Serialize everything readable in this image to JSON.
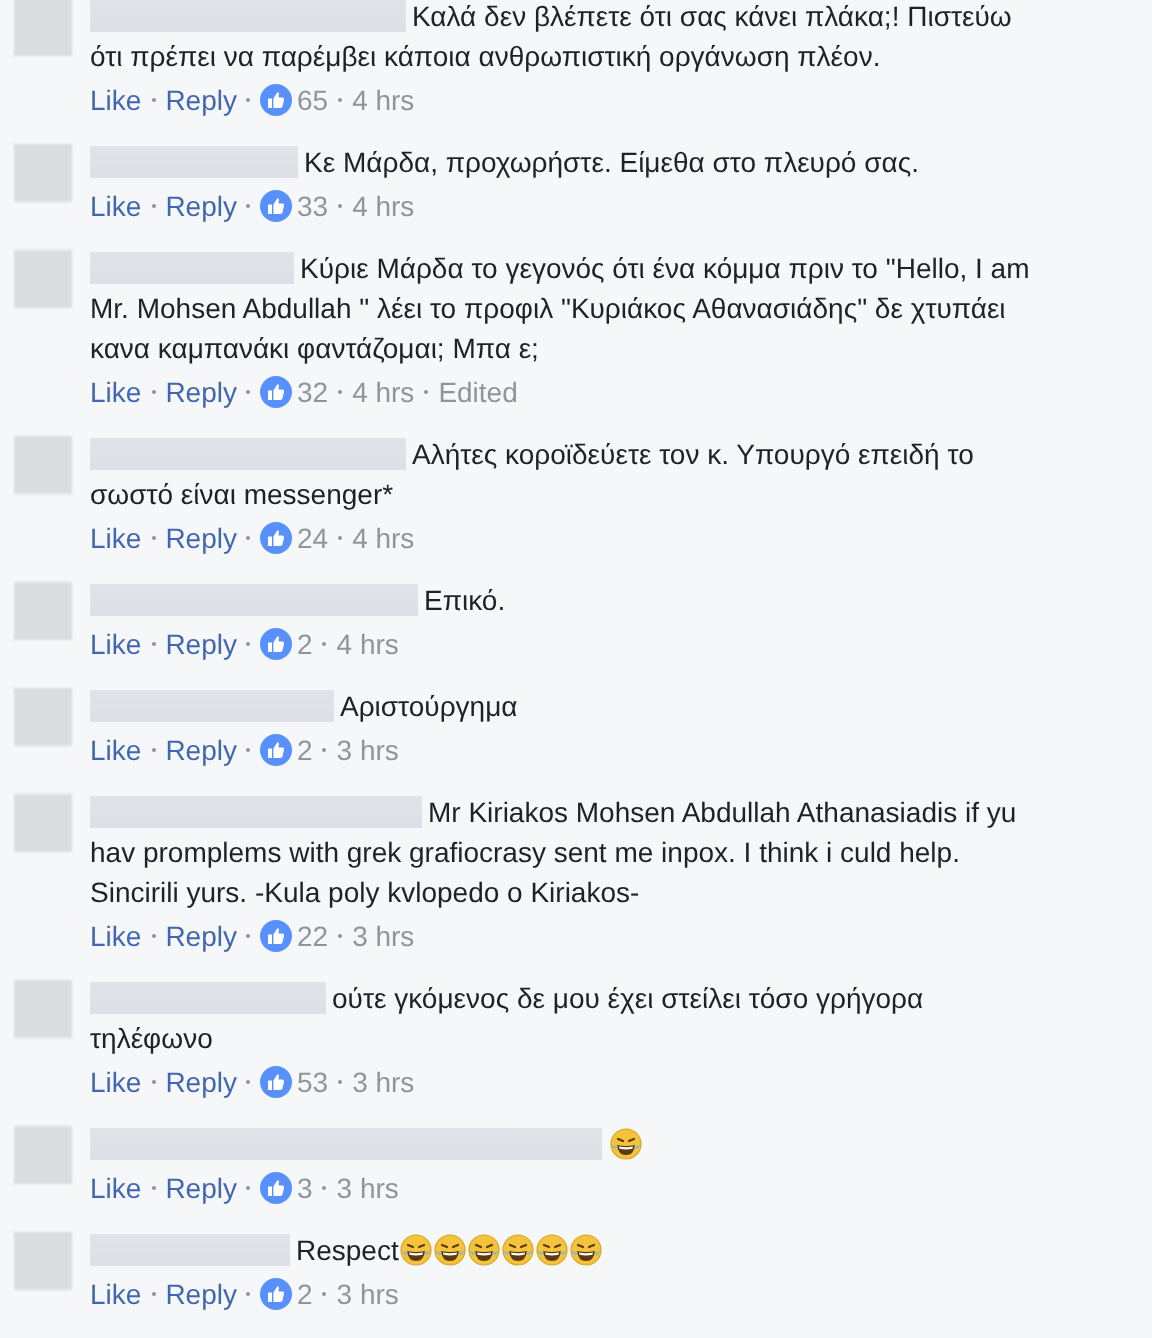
{
  "comments": [
    {
      "text": "Καλά δεν βλέπετε ότι σας κάνει πλάκα;! Πιστεύω ότι πρέπει να παρέμβει κάποια ανθρωπιστική οργάνωση πλέον.",
      "like_label": "Like",
      "reply_label": "Reply",
      "likes": "65",
      "time": "4 hrs"
    },
    {
      "text": "Κε Μάρδα, προχωρήστε. Είμεθα στο πλευρό σας.",
      "like_label": "Like",
      "reply_label": "Reply",
      "likes": "33",
      "time": "4 hrs"
    },
    {
      "text": "Κύριε Μάρδα το γεγονός ότι ένα κόμμα πριν το \"Hello, I am Mr. Mohsen Abdullah \" λέει το προφιλ \"Κυριάκος Αθανασιάδης\" δε χτυπάει κανα καμπανάκι φαντάζομαι; Μπα ε;",
      "like_label": "Like",
      "reply_label": "Reply",
      "likes": "32",
      "time": "4 hrs",
      "edited": "Edited"
    },
    {
      "text": "Αλήτες κοροϊδεύετε τον κ. Υπουργό επειδή το σωστό είναι messenger*",
      "like_label": "Like",
      "reply_label": "Reply",
      "likes": "24",
      "time": "4 hrs"
    },
    {
      "text": "Επικό.",
      "like_label": "Like",
      "reply_label": "Reply",
      "likes": "2",
      "time": "4 hrs"
    },
    {
      "text": "Αριστούργημα",
      "like_label": "Like",
      "reply_label": "Reply",
      "likes": "2",
      "time": "3 hrs"
    },
    {
      "text": "Mr Kiriakos Mohsen Abdullah Athanasiadis if yu hav promplems with grek grafiocrasy sent me inpox. I think i culd help. Sincirili yurs. -Kula poly kvlopedo o Kiriakos-",
      "like_label": "Like",
      "reply_label": "Reply",
      "likes": "22",
      "time": "3 hrs"
    },
    {
      "text": "ούτε γκόμενος δε μου έχει στείλει τόσο γρήγορα τηλέφωνο",
      "like_label": "Like",
      "reply_label": "Reply",
      "likes": "53",
      "time": "3 hrs"
    },
    {
      "emojis": [
        {
          "kind": "laughing-tears"
        }
      ],
      "like_label": "Like",
      "reply_label": "Reply",
      "likes": "3",
      "time": "3 hrs"
    },
    {
      "text": "Respect",
      "emojis": [
        {
          "kind": "laughing-tears"
        },
        {
          "kind": "laughing-tears"
        },
        {
          "kind": "laughing-tears"
        },
        {
          "kind": "laughing-tears"
        },
        {
          "kind": "laughing-tears"
        },
        {
          "kind": "laughing-tears"
        }
      ],
      "like_label": "Like",
      "reply_label": "Reply",
      "likes": "2",
      "time": "3 hrs"
    }
  ]
}
